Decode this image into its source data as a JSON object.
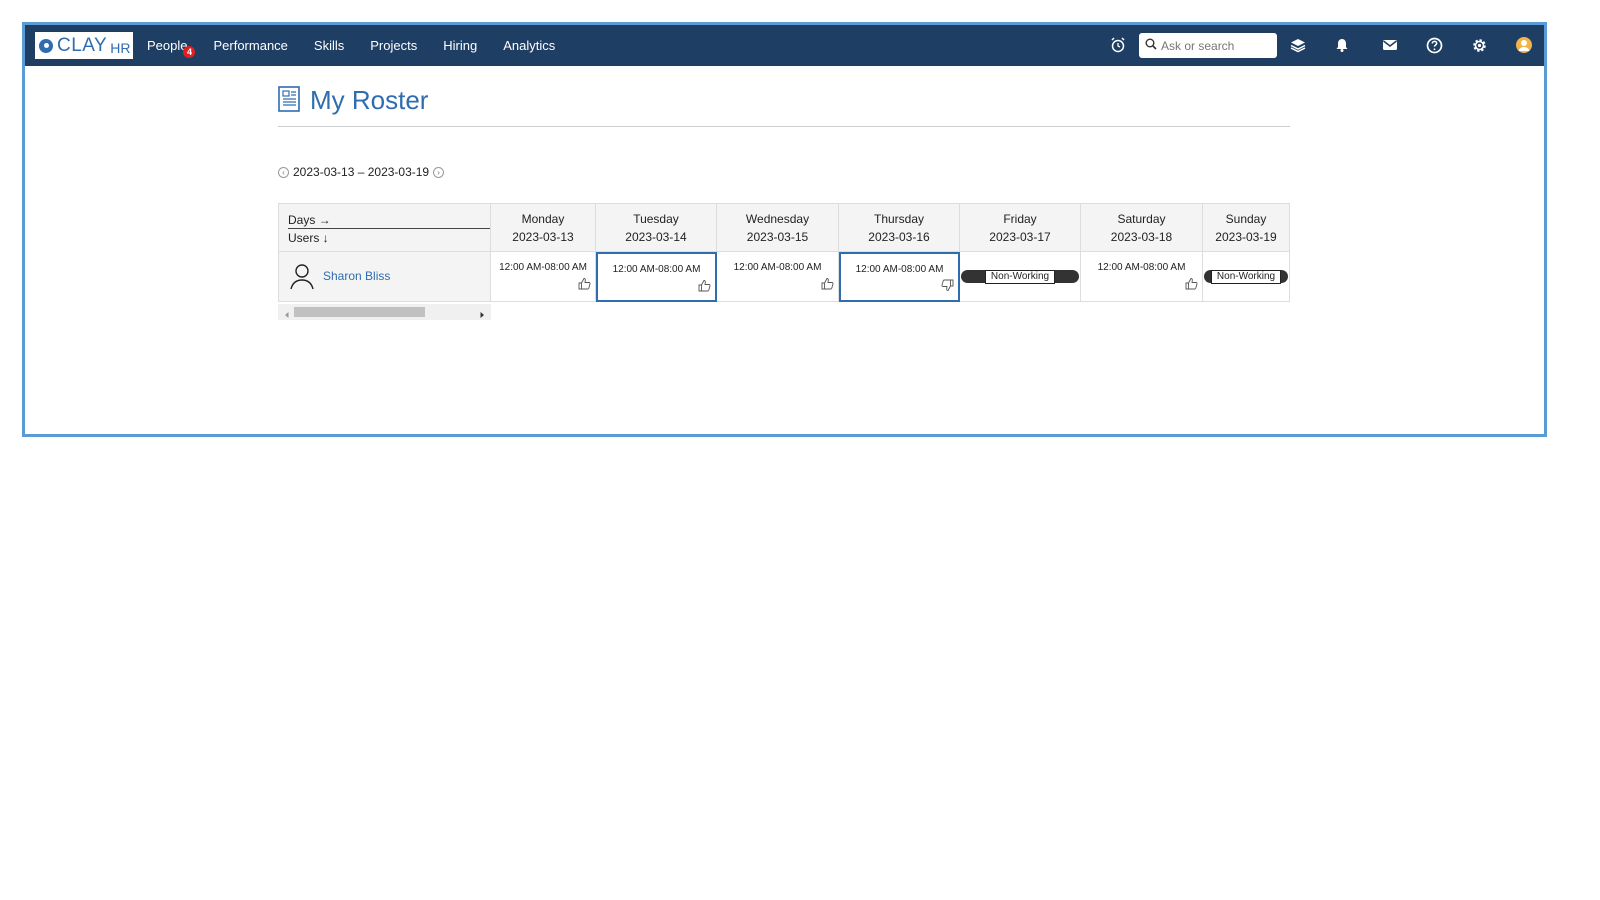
{
  "app": {
    "logo_text": "CLAY",
    "logo_suffix": "HR"
  },
  "nav": {
    "items": [
      {
        "label": "People",
        "badge": "4"
      },
      {
        "label": "Performance"
      },
      {
        "label": "Skills"
      },
      {
        "label": "Projects"
      },
      {
        "label": "Hiring"
      },
      {
        "label": "Analytics"
      }
    ]
  },
  "toolbar": {
    "search_placeholder": "Ask or search",
    "icons": [
      "alarm-icon",
      "search-icon",
      "layers-icon",
      "bell-icon",
      "mail-icon",
      "help-icon",
      "gear-icon",
      "user-avatar-icon"
    ]
  },
  "page": {
    "title": "My Roster",
    "title_icon": "document-icon"
  },
  "week": {
    "range": "2023-03-13 – 2023-03-19"
  },
  "roster": {
    "corner_days": "Days →",
    "corner_users": "Users ↓",
    "days": [
      {
        "name": "Monday",
        "date": "2023-03-13"
      },
      {
        "name": "Tuesday",
        "date": "2023-03-14"
      },
      {
        "name": "Wednesday",
        "date": "2023-03-15"
      },
      {
        "name": "Thursday",
        "date": "2023-03-16"
      },
      {
        "name": "Friday",
        "date": "2023-03-17"
      },
      {
        "name": "Saturday",
        "date": "2023-03-18"
      },
      {
        "name": "Sunday",
        "date": "2023-03-19"
      }
    ],
    "users": [
      {
        "name": "Sharon Bliss",
        "shifts": [
          {
            "time": "12:00 AM-08:00 AM",
            "status": "thumbs-up",
            "selected": false
          },
          {
            "time": "12:00 AM-08:00 AM",
            "status": "thumbs-up",
            "selected": true
          },
          {
            "time": "12:00 AM-08:00 AM",
            "status": "thumbs-up",
            "selected": false
          },
          {
            "time": "12:00 AM-08:00 AM",
            "status": "thumbs-down",
            "selected": true
          },
          {
            "time": "Non-Working",
            "status": "non-working",
            "selected": false
          },
          {
            "time": "12:00 AM-08:00 AM",
            "status": "thumbs-up",
            "selected": false
          },
          {
            "time": "Non-Working",
            "status": "non-working",
            "selected": false
          }
        ]
      }
    ]
  },
  "colors": {
    "topbar": "#1e3e63",
    "accent": "#2f6db0",
    "frame": "#5b9bd5",
    "badge": "#e02020"
  }
}
